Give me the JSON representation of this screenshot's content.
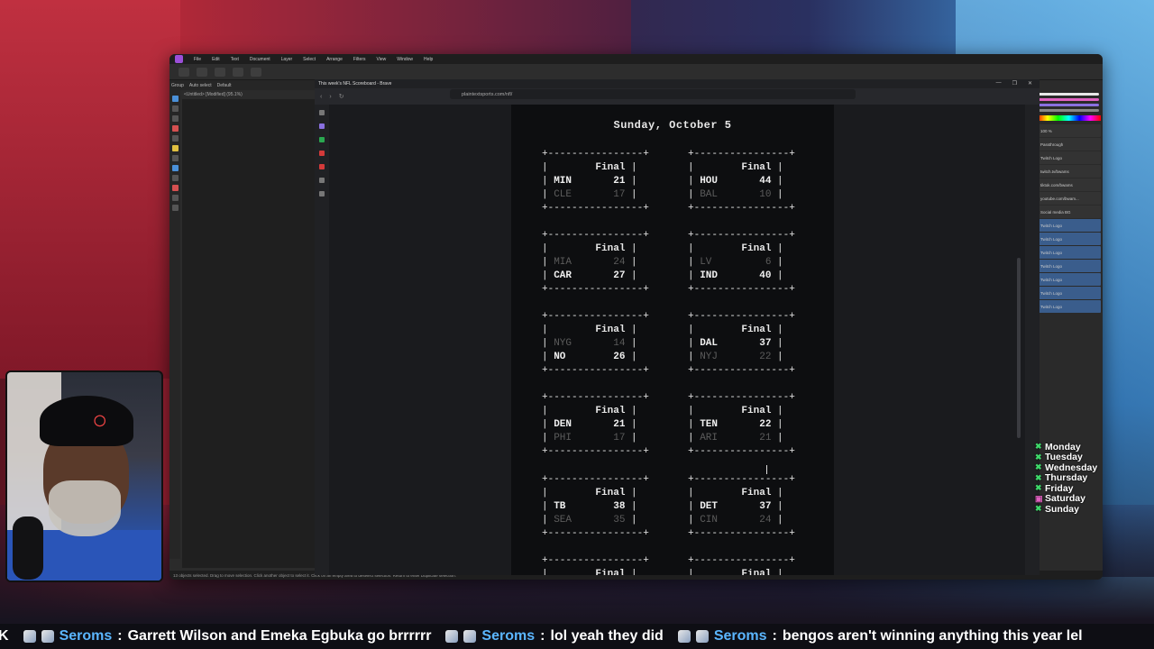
{
  "affinity": {
    "menu": [
      "File",
      "Edit",
      "Text",
      "Document",
      "Layer",
      "Select",
      "Arrange",
      "Filters",
      "View",
      "Window",
      "Help"
    ],
    "context": [
      "Group",
      "Auto select",
      "Default"
    ],
    "doc_tab": "<Untitled> [Modified] (95.1%)",
    "status": "13 objects selected. Drag to move selection. Click another object to select it. Click on an empty area to deselect selection. Return to enter Duplicate selection.",
    "layers": [
      "Twitch Logo",
      "twitch.tv/bwams",
      "tiktok.com/bwams",
      "youtube.com/bwam...",
      "Social media BG",
      "Twitch Logo",
      "Twitch Logo",
      "Twitch Logo",
      "Twitch Logo",
      "Twitch Logo",
      "Twitch Logo",
      "Twitch Logo"
    ],
    "blend_mode": "Passthrough",
    "opacity": "100 %"
  },
  "browser": {
    "tab_title": "This week's NFL Scoreboard - Brave",
    "url": "plaintextsports.com/nfl/",
    "win_ctrls": [
      "—",
      "❐",
      "✕"
    ]
  },
  "scoreboard": {
    "day": "Sunday, October 5",
    "games": [
      {
        "status": "Final",
        "top": {
          "team": "MIN",
          "score": "21",
          "won": true
        },
        "bottom": {
          "team": "CLE",
          "score": "17",
          "won": false
        }
      },
      {
        "status": "Final",
        "top": {
          "team": "HOU",
          "score": "44",
          "won": true
        },
        "bottom": {
          "team": "BAL",
          "score": "10",
          "won": false
        }
      },
      {
        "status": "Final",
        "top": {
          "team": "MIA",
          "score": "24",
          "won": false
        },
        "bottom": {
          "team": "CAR",
          "score": "27",
          "won": true
        }
      },
      {
        "status": "Final",
        "top": {
          "team": "LV",
          "score": "6",
          "won": false
        },
        "bottom": {
          "team": "IND",
          "score": "40",
          "won": true
        }
      },
      {
        "status": "Final",
        "top": {
          "team": "NYG",
          "score": "14",
          "won": false
        },
        "bottom": {
          "team": "NO",
          "score": "26",
          "won": true
        }
      },
      {
        "status": "Final",
        "top": {
          "team": "DAL",
          "score": "37",
          "won": true
        },
        "bottom": {
          "team": "NYJ",
          "score": "22",
          "won": false
        }
      },
      {
        "status": "Final",
        "top": {
          "team": "DEN",
          "score": "21",
          "won": true
        },
        "bottom": {
          "team": "PHI",
          "score": "17",
          "won": false
        }
      },
      {
        "status": "Final",
        "top": {
          "team": "TEN",
          "score": "22",
          "won": true
        },
        "bottom": {
          "team": "ARI",
          "score": "21",
          "won": false
        }
      },
      {
        "status": "Final",
        "top": {
          "team": "TB",
          "score": "38",
          "won": true
        },
        "bottom": {
          "team": "SEA",
          "score": "35",
          "won": false
        }
      },
      {
        "status": "Final",
        "top": {
          "team": "DET",
          "score": "37",
          "won": true
        },
        "bottom": {
          "team": "CIN",
          "score": "24",
          "won": false
        }
      },
      {
        "status": "Final",
        "top": null,
        "bottom": null
      },
      {
        "status": "Final",
        "top": null,
        "bottom": null
      }
    ]
  },
  "checklist": [
    {
      "day": "Monday",
      "state": "done",
      "mark": "✖"
    },
    {
      "day": "Tuesday",
      "state": "done",
      "mark": "✖"
    },
    {
      "day": "Wednesday",
      "state": "done",
      "mark": "✖"
    },
    {
      "day": "Thursday",
      "state": "done",
      "mark": "✖"
    },
    {
      "day": "Friday",
      "state": "done",
      "mark": "✖"
    },
    {
      "day": "Saturday",
      "state": "pending",
      "mark": "▣"
    },
    {
      "day": "Sunday",
      "state": "done",
      "mark": "✖"
    }
  ],
  "ticker": {
    "lead_fragment": "K",
    "messages": [
      {
        "user": "Seroms",
        "text": "Garrett Wilson and Emeka Egbuka go brrrrrr"
      },
      {
        "user": "Seroms",
        "text": "lol yeah they did"
      },
      {
        "user": "Seroms",
        "text": "bengos aren't winning anything this year lel"
      }
    ]
  },
  "colors": {
    "link_user": "#5bb6ff",
    "check_done": "#3ed86a",
    "check_pending": "#e060c0",
    "loser_score": "#5c5c5c"
  }
}
